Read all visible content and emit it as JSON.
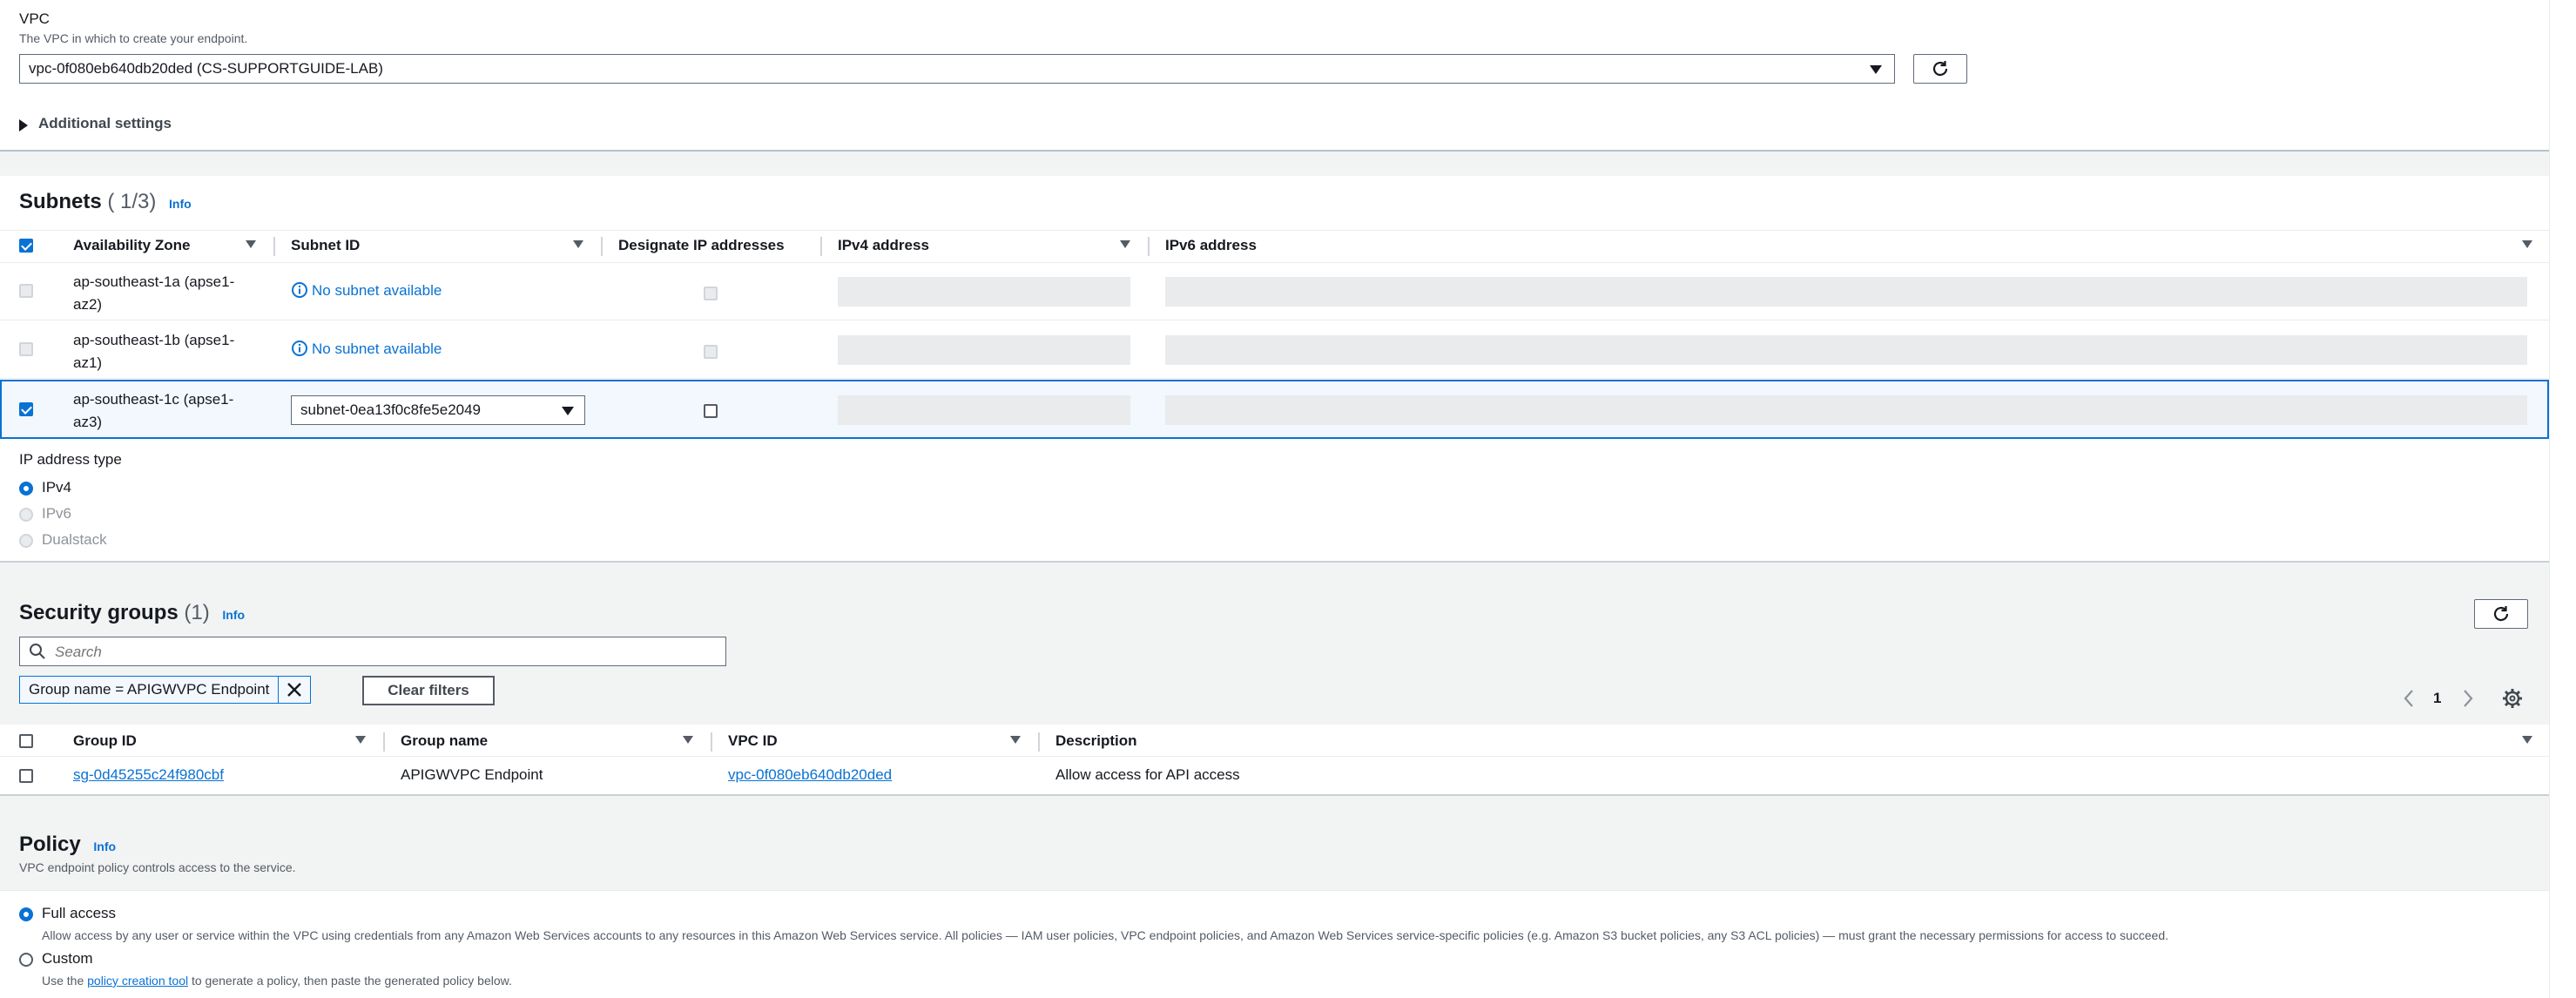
{
  "vpc": {
    "label": "VPC",
    "description": "The VPC in which to create your endpoint.",
    "selected": "vpc-0f080eb640db20ded (CS-SUPPORTGUIDE-LAB)"
  },
  "additional_settings": {
    "label": "Additional settings"
  },
  "subnets": {
    "title": "Subnets",
    "count": "( 1/3)",
    "info": "Info",
    "headers": {
      "az": "Availability Zone",
      "subnet_id": "Subnet ID",
      "designate": "Designate IP addresses",
      "ipv4": "IPv4 address",
      "ipv6": "IPv6 address"
    },
    "rows": [
      {
        "az_line1": "ap-southeast-1a (apse1-",
        "az_line2": "az2)",
        "subnet": "No subnet available"
      },
      {
        "az_line1": "ap-southeast-1b (apse1-",
        "az_line2": "az1)",
        "subnet": "No subnet available"
      },
      {
        "az_line1": "ap-southeast-1c (apse1-",
        "az_line2": "az3)",
        "subnet": "subnet-0ea13f0c8fe5e2049"
      }
    ]
  },
  "ip_address_type": {
    "label": "IP address type",
    "options": [
      "IPv4",
      "IPv6",
      "Dualstack"
    ],
    "selected": "IPv4"
  },
  "security_groups": {
    "title": "Security groups",
    "count": "(1)",
    "info": "Info",
    "search_placeholder": "Search",
    "filter_token": "Group name = APIGWVPC Endpoint",
    "clear_filters": "Clear filters",
    "page": "1",
    "headers": {
      "group_id": "Group ID",
      "group_name": "Group name",
      "vpc_id": "VPC ID",
      "description": "Description"
    },
    "rows": [
      {
        "group_id": "sg-0d45255c24f980cbf",
        "group_name": "APIGWVPC Endpoint",
        "vpc_id": "vpc-0f080eb640db20ded",
        "description": "Allow access for API access"
      }
    ]
  },
  "policy": {
    "title": "Policy",
    "info": "Info",
    "description": "VPC endpoint policy controls access to the service.",
    "full_access_label": "Full access",
    "full_access_desc": "Allow access by any user or service within the VPC using credentials from any Amazon Web Services accounts to any resources in this Amazon Web Services service. All policies — IAM user policies, VPC endpoint policies, and Amazon Web Services service-specific policies (e.g. Amazon S3 bucket policies, any S3 ACL policies) — must grant the necessary permissions for access to succeed.",
    "custom_label": "Custom",
    "custom_desc_pre": "Use the",
    "custom_desc_link": "policy creation tool",
    "custom_desc_post": "to generate a policy, then paste the generated policy below."
  },
  "colors": {
    "accent": "#0972d3",
    "text": "#16191f",
    "band": "#f2f3f3",
    "placeholder": "#e9ebed"
  }
}
